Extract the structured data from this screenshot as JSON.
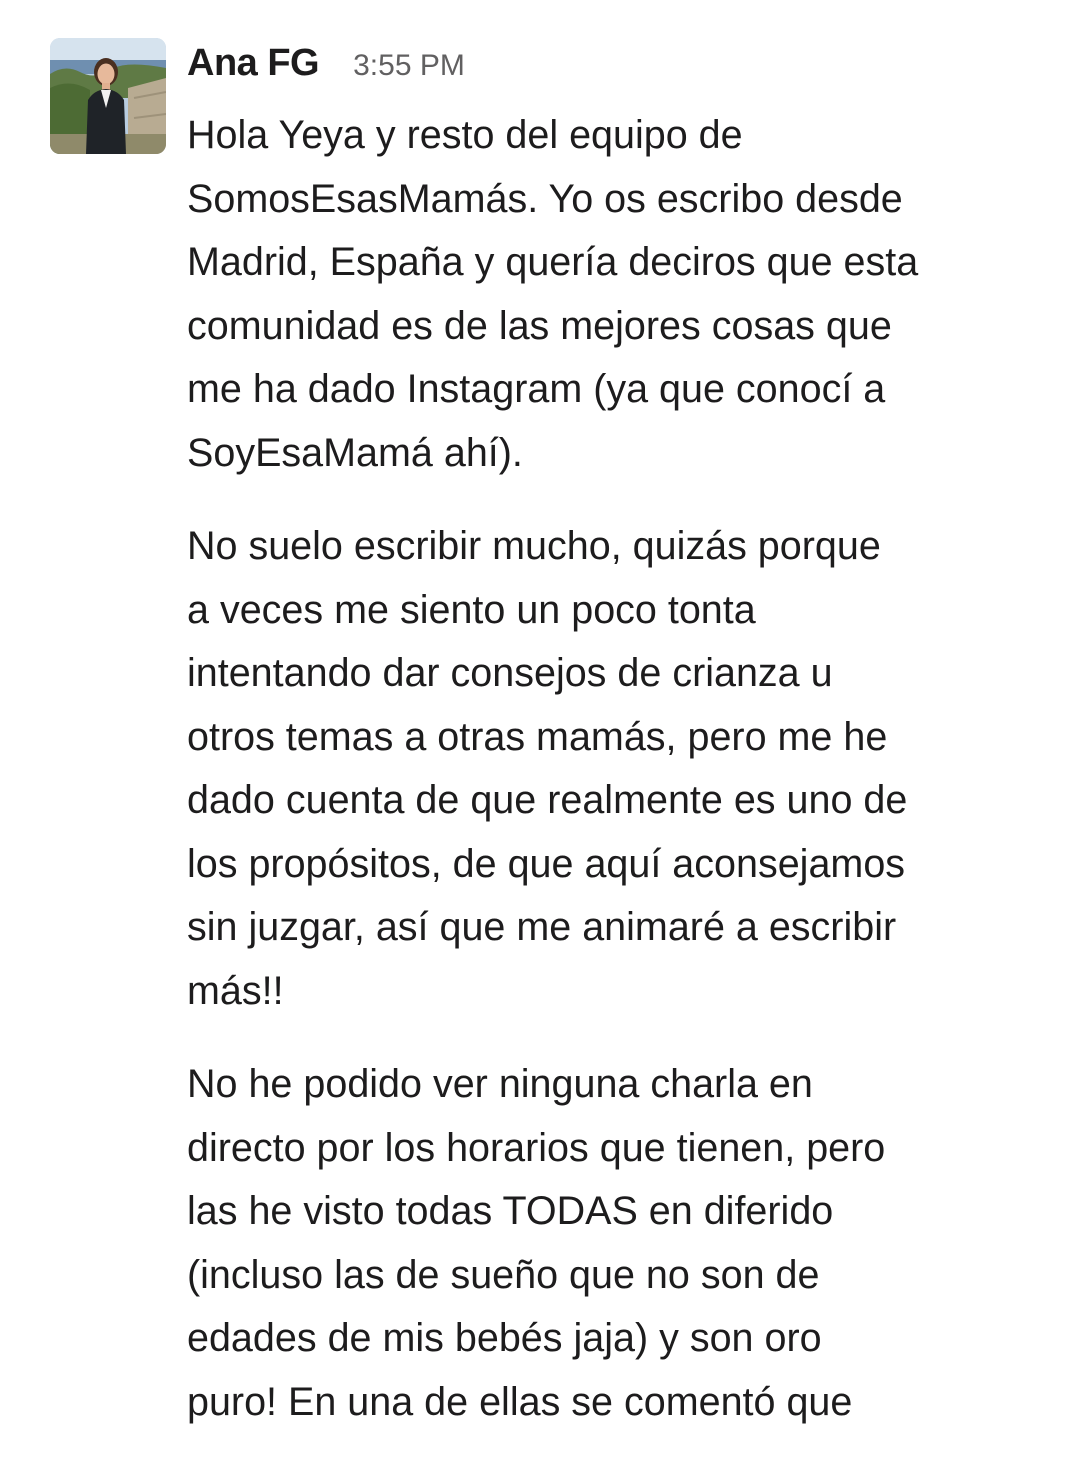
{
  "message": {
    "sender": "Ana FG",
    "timestamp": "3:55 PM",
    "avatar_icon": "profile-photo",
    "paragraphs": [
      {
        "lines": [
          "Hola Yeya y resto del equipo de",
          "SomosEsasMamás. Yo os escribo desde",
          "Madrid, España y quería deciros que esta",
          "comunidad es de las mejores cosas que",
          "me ha dado Instagram (ya que conocí a",
          "SoyEsaMamá ahí)."
        ]
      },
      {
        "lines": [
          "No suelo escribir mucho, quizás porque",
          "a veces me siento un poco tonta",
          "intentando dar consejos de crianza u",
          "otros temas a otras mamás, pero me he",
          "dado cuenta de que realmente es uno de",
          "los propósitos, de que aquí aconsejamos",
          "sin juzgar, así que me animaré a escribir",
          "más!!"
        ]
      },
      {
        "lines": [
          "No he podido ver ninguna charla en",
          "directo por los horarios que tienen, pero",
          "las he visto todas TODAS en diferido",
          "(incluso las de sueño que no son de",
          "edades de mis bebés jaja) y son oro",
          "puro! En una de ellas se comentó que"
        ]
      }
    ]
  }
}
